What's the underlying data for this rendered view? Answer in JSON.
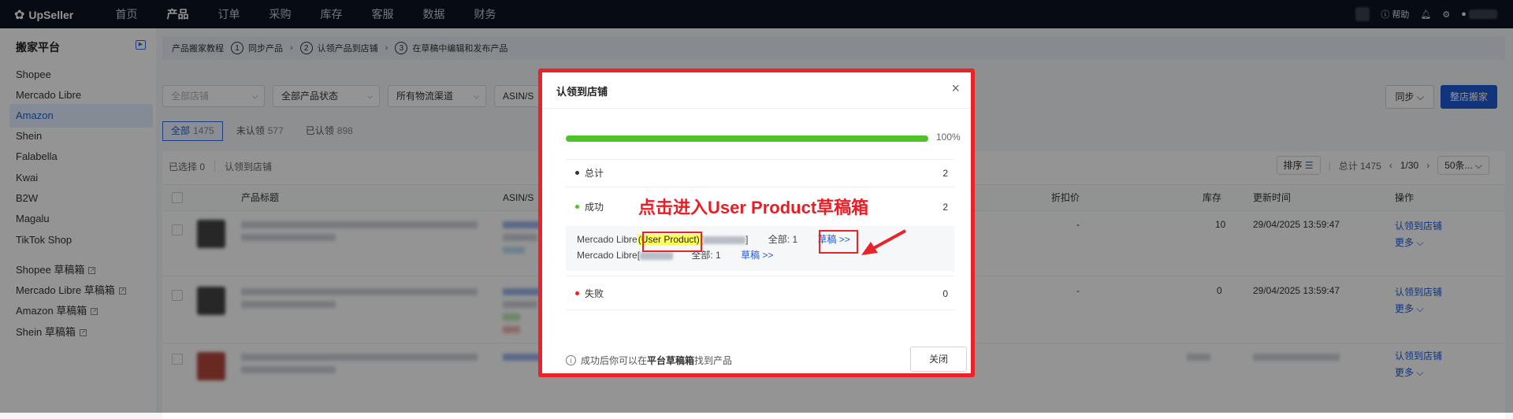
{
  "topbar": {
    "brand": "UpSeller",
    "nav": [
      "首页",
      "产品",
      "订单",
      "采购",
      "库存",
      "客服",
      "数据",
      "财务"
    ],
    "active_nav": "产品",
    "help": "帮助"
  },
  "sidebar": {
    "title": "搬家平台",
    "items": [
      "Shopee",
      "Mercado Libre",
      "Amazon",
      "Shein",
      "Falabella",
      "Kwai",
      "B2W",
      "Magalu",
      "TikTok Shop"
    ],
    "active": "Amazon",
    "drafts": [
      "Shopee 草稿箱",
      "Mercado Libre 草稿箱",
      "Amazon 草稿箱",
      "Shein 草稿箱"
    ]
  },
  "tutorial": {
    "label": "产品搬家教程",
    "steps": [
      {
        "num": "1",
        "label": "同步产品"
      },
      {
        "num": "2",
        "label": "认领产品到店铺"
      },
      {
        "num": "3",
        "label": "在草稿中编辑和发布产品"
      }
    ]
  },
  "filters": {
    "shop_placeholder": "全部店铺",
    "status": "全部产品状态",
    "channel": "所有物流渠道",
    "asin": "ASIN/S"
  },
  "actions": {
    "sync": "同步",
    "whole_store": "整店搬家"
  },
  "status_tabs": [
    {
      "label": "全部",
      "count": "1475"
    },
    {
      "label": "未认领",
      "count": "577"
    },
    {
      "label": "已认领",
      "count": "898"
    }
  ],
  "toolbar": {
    "selected": "已选择 0",
    "claim": "认领到店铺"
  },
  "pager": {
    "sort": "排序",
    "total": "总计 1475",
    "page": "1/30",
    "per_page": "50条..."
  },
  "table": {
    "headers": {
      "title": "产品标题",
      "asin": "ASIN/S",
      "discount": "折扣价",
      "stock": "库存",
      "updated": "更新时间",
      "ops": "操作"
    },
    "rows": [
      {
        "discount": "-",
        "stock": "10",
        "updated": "29/04/2025 13:59:47",
        "op_claim": "认领到店铺",
        "op_more": "更多"
      },
      {
        "discount": "-",
        "stock": "0",
        "updated": "29/04/2025 13:59:47",
        "op_claim": "认领到店铺",
        "op_more": "更多"
      },
      {
        "discount": "",
        "stock": "",
        "updated": "",
        "op_claim": "认领到店铺",
        "op_more": "更多"
      }
    ]
  },
  "modal": {
    "title": "认领到店铺",
    "progress_percent": 100,
    "progress_label": "100%",
    "total_label": "总计",
    "total_value": "2",
    "success_label": "成功",
    "success_value": "2",
    "line1": {
      "platform": "Mercado Libre",
      "highlight": "(User Product)",
      "bracket_open": "[",
      "bracket_close": "]",
      "all": "全部: 1",
      "link": "草稿 >>"
    },
    "line2": {
      "platform": "Mercado Libre[",
      "all": "全部: 1",
      "link": "草稿 >>"
    },
    "fail_label": "失败",
    "fail_value": "0",
    "tip_prefix": "成功后你可以在",
    "tip_bold": "平台草稿箱",
    "tip_suffix": "找到产品",
    "close_button": "关闭",
    "annotation": "点击进入User Product草稿箱"
  },
  "colors": {
    "accent": "#1f5ad6",
    "success": "#4fc12a",
    "annotation_red": "#e8232a",
    "highlight": "#ffff58"
  }
}
